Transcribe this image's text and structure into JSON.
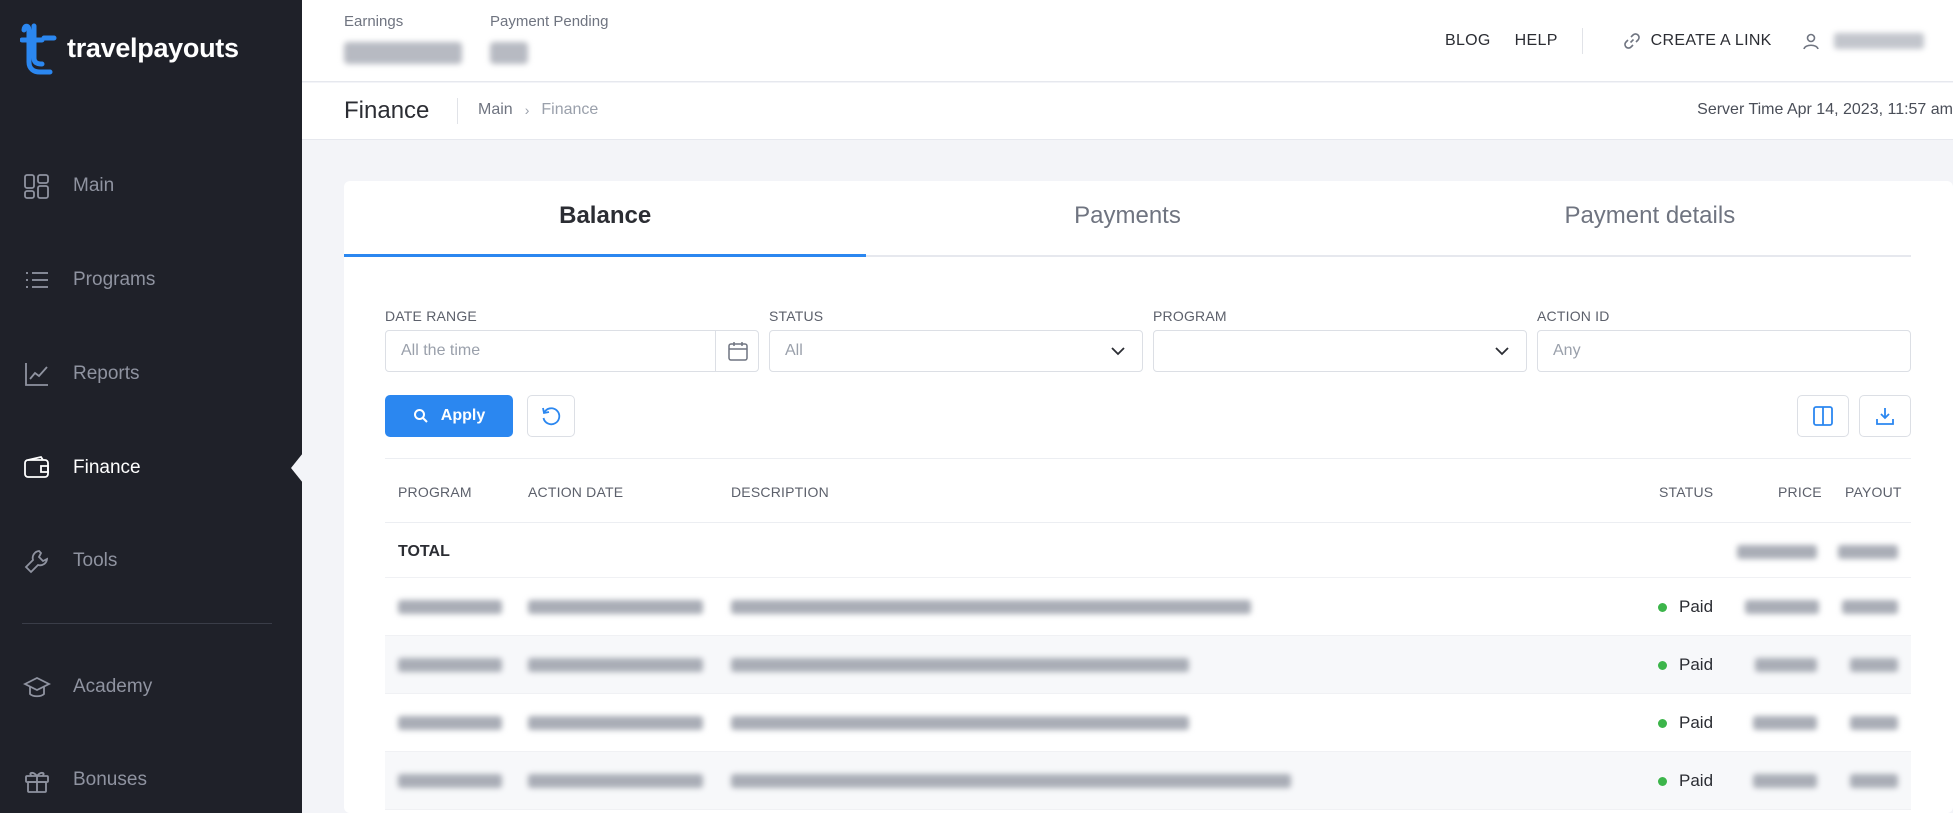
{
  "brand": {
    "name": "travelpayouts"
  },
  "sidebar": {
    "items": [
      {
        "label": "Main",
        "icon": "grid-icon"
      },
      {
        "label": "Programs",
        "icon": "list-icon"
      },
      {
        "label": "Reports",
        "icon": "chart-icon"
      },
      {
        "label": "Finance",
        "icon": "wallet-icon",
        "active": true
      },
      {
        "label": "Tools",
        "icon": "wrench-icon"
      },
      {
        "label": "Academy",
        "icon": "graduation-cap-icon"
      },
      {
        "label": "Bonuses",
        "icon": "gift-icon"
      }
    ]
  },
  "header": {
    "earnings_label": "Earnings",
    "pending_label": "Payment Pending",
    "blog": "BLOG",
    "help": "HELP",
    "create_link": "CREATE A LINK"
  },
  "page": {
    "title": "Finance",
    "breadcrumb": [
      "Main",
      "Finance"
    ],
    "server_time": "Server Time Apr 14, 2023, 11:57 am"
  },
  "tabs": [
    "Balance",
    "Payments",
    "Payment details"
  ],
  "filters": {
    "date_range": {
      "label": "DATE RANGE",
      "value": "All the time"
    },
    "status": {
      "label": "STATUS",
      "value": "All"
    },
    "program": {
      "label": "PROGRAM",
      "value": ""
    },
    "action_id": {
      "label": "ACTION ID",
      "placeholder": "Any"
    }
  },
  "actions": {
    "apply": "Apply"
  },
  "table": {
    "columns": [
      "PROGRAM",
      "ACTION DATE",
      "DESCRIPTION",
      "STATUS",
      "PRICE",
      "PAYOUT"
    ],
    "total_label": "TOTAL",
    "rows": [
      {
        "status": "Paid"
      },
      {
        "status": "Paid"
      },
      {
        "status": "Paid"
      },
      {
        "status": "Paid"
      }
    ]
  },
  "colors": {
    "accent": "#2b87f0",
    "sidebar_bg": "#1f2129",
    "paid": "#3cb54a"
  }
}
